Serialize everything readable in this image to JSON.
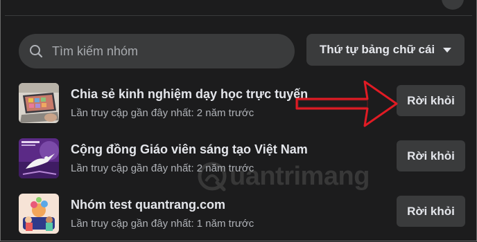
{
  "search": {
    "placeholder": "Tìm kiếm nhóm",
    "icon": "search-icon"
  },
  "sort": {
    "label": "Thứ tự bảng chữ cái",
    "icon": "caret-down-icon"
  },
  "groups": [
    {
      "name": "Chia sẻ kinh nghiệm dạy học trực tuyến",
      "last_visit": "Lần truy cập gần đây nhất: 2 năm trước",
      "leave_label": "Rời khỏi"
    },
    {
      "name": "Cộng đồng Giáo viên sáng tạo Việt Nam",
      "last_visit": "Lần truy cập gần đây nhất: 2 năm trước",
      "leave_label": "Rời khỏi"
    },
    {
      "name": "Nhóm test quantrang.com",
      "last_visit": "Lần truy cập gần đây nhất: 1 năm trước",
      "leave_label": "Rời khỏi"
    }
  ],
  "annotation": {
    "arrow_color": "#e01b24"
  },
  "watermark": {
    "text": "uantrimang"
  },
  "colors": {
    "background": "#1c1c1d",
    "surface": "#3a3b3c",
    "text_primary": "#e4e6eb",
    "text_secondary": "#b0b3b8"
  }
}
